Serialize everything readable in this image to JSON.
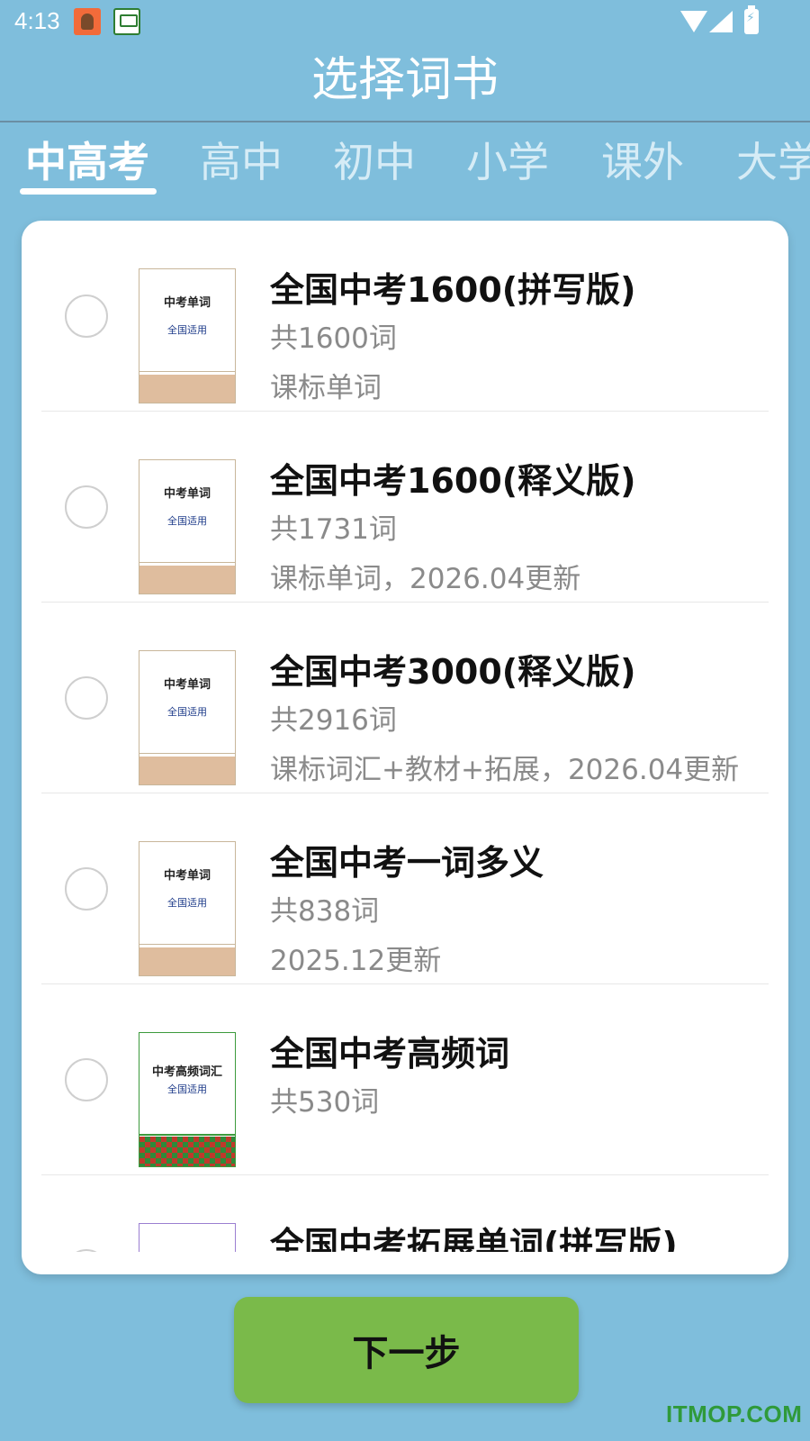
{
  "status_bar": {
    "time": "4:13",
    "icons": [
      "notification-app-icon",
      "notification-app-icon",
      "wifi-icon",
      "signal-icon",
      "battery-charging-icon"
    ]
  },
  "header": {
    "title": "选择词书"
  },
  "tabs": [
    {
      "label": "中高考",
      "active": true
    },
    {
      "label": "高中",
      "active": false
    },
    {
      "label": "初中",
      "active": false
    },
    {
      "label": "小学",
      "active": false
    },
    {
      "label": "课外",
      "active": false
    },
    {
      "label": "大学",
      "active": false
    }
  ],
  "books": [
    {
      "title": "全国中考1600(拼写版)",
      "count": "共1600词",
      "note": "课标单词",
      "cover_title": "中考单词",
      "cover_sub": "全国适用",
      "selected": false
    },
    {
      "title": "全国中考1600(释义版)",
      "count": "共1731词",
      "note": "课标单词，2026.04更新",
      "cover_title": "中考单词",
      "cover_sub": "全国适用",
      "selected": false
    },
    {
      "title": "全国中考3000(释义版)",
      "count": "共2916词",
      "note": "课标词汇+教材+拓展，2026.04更新",
      "cover_title": "中考单词",
      "cover_sub": "全国适用",
      "selected": false
    },
    {
      "title": "全国中考一词多义",
      "count": "共838词",
      "note": "2025.12更新",
      "cover_title": "中考单词",
      "cover_sub": "全国适用",
      "selected": false
    },
    {
      "title": "全国中考高频词",
      "count": "共530词",
      "note": "",
      "cover_title": "中考高频词汇",
      "cover_sub": "全国适用",
      "selected": false
    },
    {
      "title": "全国中考拓展单词(拼写版)",
      "count": "",
      "note": "",
      "cover_title": "",
      "cover_sub": "",
      "selected": false
    }
  ],
  "footer": {
    "next_label": "下一步"
  },
  "watermark": "ITMOP.COM",
  "colors": {
    "background": "#7fbedc",
    "button": "#7aba4a",
    "watermark": "#2f9a3a"
  }
}
